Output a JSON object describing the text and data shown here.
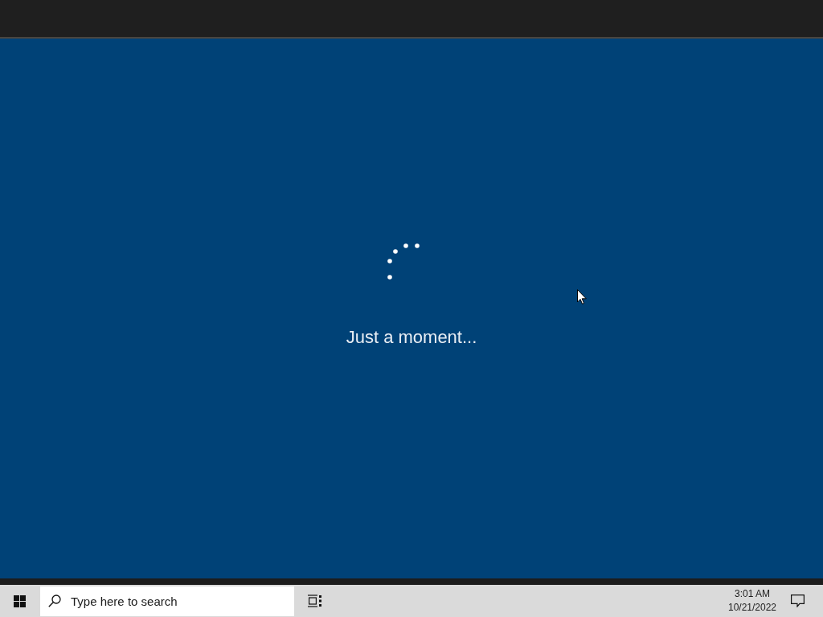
{
  "status": {
    "message": "Just a moment..."
  },
  "taskbar": {
    "search": {
      "placeholder": "Type here to search"
    },
    "clock": {
      "time": "3:01 AM",
      "date": "10/21/2022"
    }
  }
}
